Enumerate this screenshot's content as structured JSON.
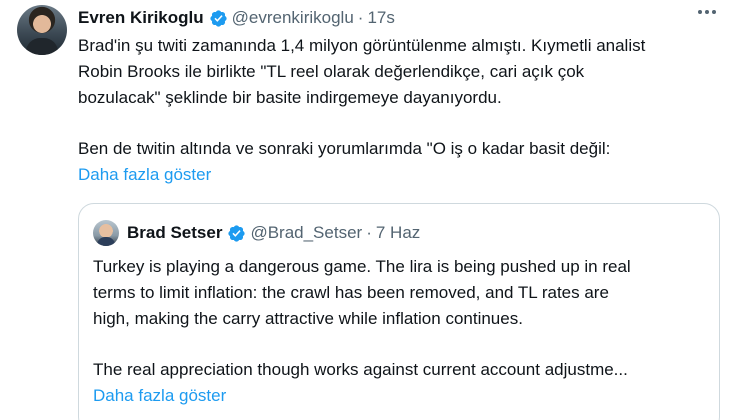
{
  "tweet": {
    "author": {
      "display_name": "Evren Kirikoglu",
      "handle": "@evrenkirikoglu",
      "verified_icon": "verified-badge-icon",
      "avatar_icon": "profile-photo"
    },
    "separator": "·",
    "time": "17s",
    "more_icon": "more-options-icon",
    "text_lines": [
      "Brad'in şu twiti zamanında 1,4 milyon görüntülenme almıştı. Kıymetli analist",
      "Robin Brooks ile birlikte \"TL reel olarak değerlendikçe, cari açık çok",
      "bozulacak\" şeklinde bir basite indirgemeye dayanıyordu.",
      "Ben de twitin altında ve sonraki yorumlarımda \"O iş o kadar basit değil:"
    ],
    "show_more": "Daha fazla göster",
    "quote": {
      "author": {
        "display_name": "Brad Setser",
        "handle": "@Brad_Setser",
        "verified_icon": "verified-badge-icon",
        "avatar_icon": "profile-photo"
      },
      "separator": "·",
      "date": "7 Haz",
      "text_lines": [
        "Turkey is playing a dangerous game. The lira is being pushed up in real",
        "terms to limit inflation: the crawl has been removed, and TL rates are",
        "high, making the carry attractive while inflation continues.",
        "The real appreciation though works against current account adjustme..."
      ],
      "show_more": "Daha fazla göster"
    }
  },
  "colors": {
    "text": "#0f1419",
    "secondary": "#536471",
    "link": "#1d9bf0",
    "border": "#cfd9de",
    "verified": "#1d9bf0"
  }
}
